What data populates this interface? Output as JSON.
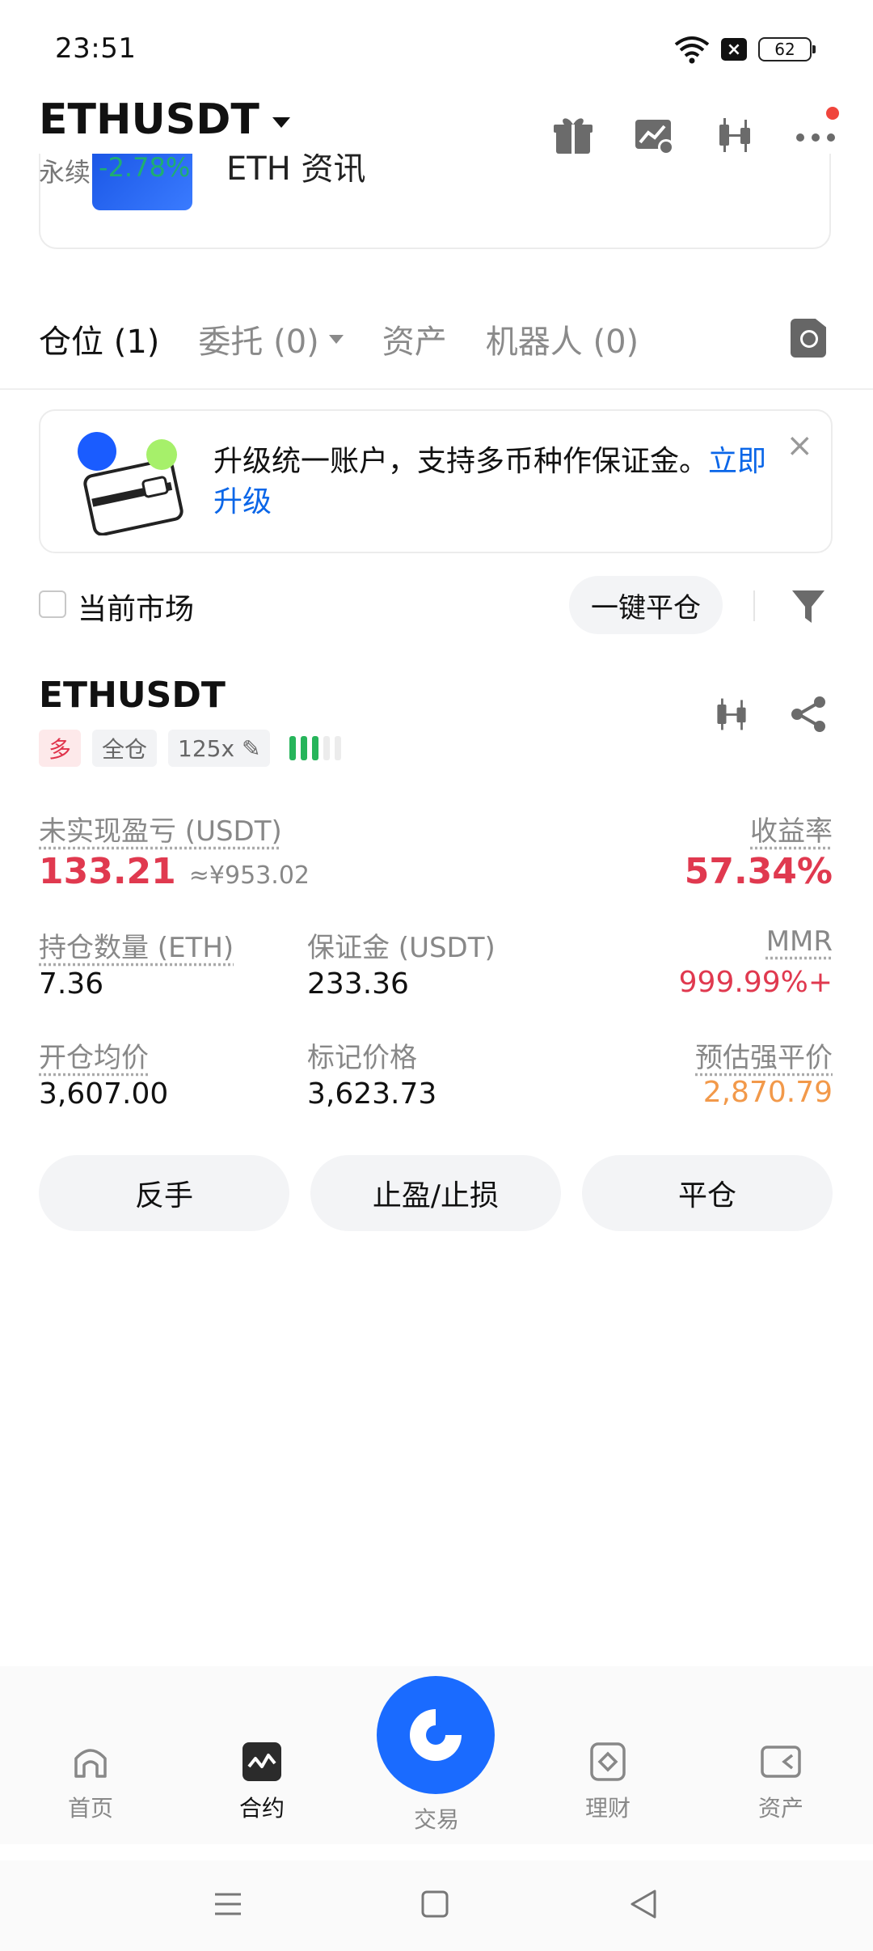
{
  "status_bar": {
    "time": "23:51",
    "battery": "62"
  },
  "header": {
    "symbol": "ETHUSDT",
    "contract_type": "永续",
    "change": "-2.78%",
    "partial_card_text": "ETH 资讯"
  },
  "tabs": [
    {
      "label": "仓位 (1)"
    },
    {
      "label": "委托 (0)"
    },
    {
      "label": "资产"
    },
    {
      "label": "机器人 (0)"
    }
  ],
  "banner": {
    "text": "升级统一账户，支持多币种作保证金。",
    "link": "立即升级"
  },
  "filter": {
    "current_market_label": "当前市场",
    "close_all_label": "一键平仓"
  },
  "position": {
    "symbol": "ETHUSDT",
    "side_tag": "多",
    "margin_mode_tag": "全仓",
    "leverage_tag": "125x",
    "risk_level_bars": {
      "filled": 3,
      "total": 5
    },
    "unrealized_pnl_label": "未实现盈亏 (USDT)",
    "unrealized_pnl": "133.21",
    "unrealized_pnl_cny": "≈¥953.02",
    "roe_label": "收益率",
    "roe": "57.34%",
    "size_label": "持仓数量 (ETH)",
    "size": "7.36",
    "margin_label": "保证金 (USDT)",
    "margin": "233.36",
    "mmr_label": "MMR",
    "mmr": "999.99%+",
    "entry_label": "开仓均价",
    "entry_price": "3,607.00",
    "mark_label": "标记价格",
    "mark_price": "3,623.73",
    "liq_label": "预估强平价",
    "liq_price": "2,870.79"
  },
  "actions": {
    "reverse": "反手",
    "tp_sl": "止盈/止损",
    "close": "平仓"
  },
  "bottom_nav": [
    {
      "label": "首页",
      "icon": "home-icon"
    },
    {
      "label": "合约",
      "icon": "futures-icon"
    },
    {
      "label": "交易",
      "icon": "trade-icon"
    },
    {
      "label": "理财",
      "icon": "earn-icon"
    },
    {
      "label": "资产",
      "icon": "wallet-icon"
    }
  ],
  "colors": {
    "up_green": "#1fae71",
    "loss_red": "#e0394f",
    "liq_orange": "#f2994a",
    "brand_blue": "#1a6bff",
    "link_blue": "#0a66e8"
  }
}
